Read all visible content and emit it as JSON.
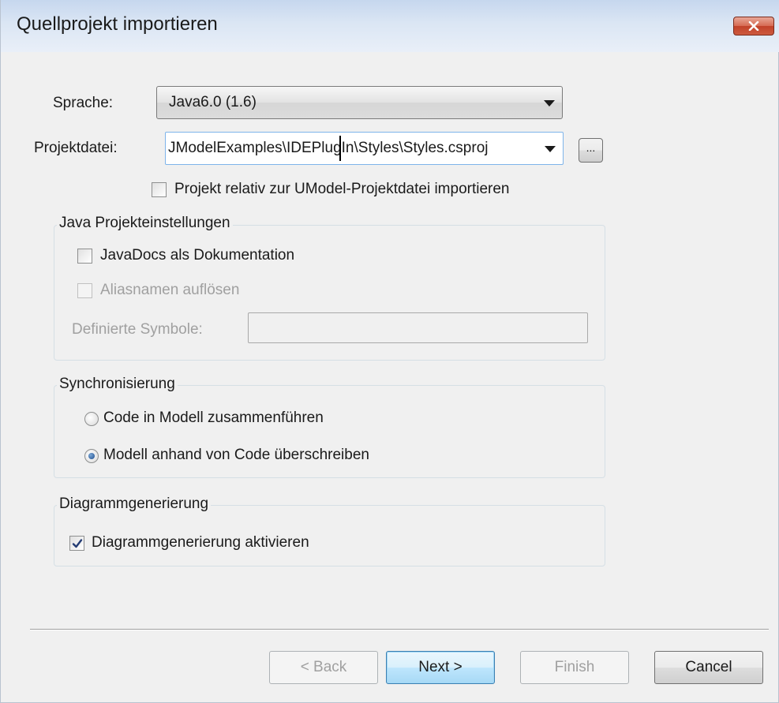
{
  "window": {
    "title": "Quellprojekt importieren",
    "close_glyph": "✕"
  },
  "form": {
    "language_label": "Sprache:",
    "language_value": "Java6.0 (1.6)",
    "project_label": "Projektdatei:",
    "project_value": "JModelExamples\\IDEPlugIn\\Styles\\Styles.csproj",
    "browse_label": "...",
    "relative_checkbox_label": "Projekt relativ zur UModel-Projektdatei importieren",
    "relative_checked": false
  },
  "java_group": {
    "title": "Java Projekteinstellungen",
    "javadocs_label": "JavaDocs als Dokumentation",
    "javadocs_checked": false,
    "alias_label": "Aliasnamen auflösen",
    "alias_checked": false,
    "alias_enabled": false,
    "symbols_label": "Definierte Symbole:",
    "symbols_value": ""
  },
  "sync_group": {
    "title": "Synchronisierung",
    "options": [
      {
        "label": "Code in Modell zusammenführen",
        "selected": false
      },
      {
        "label": "Modell anhand von Code überschreiben",
        "selected": true
      }
    ]
  },
  "diagram_group": {
    "title": "Diagrammgenerierung",
    "enable_label": "Diagrammgenerierung aktivieren",
    "enable_checked": true
  },
  "buttons": {
    "back": "< Back",
    "next": "Next >",
    "finish": "Finish",
    "cancel": "Cancel"
  },
  "colors": {
    "titlebar": "#c6d7ee",
    "dialog_bg": "#f0f0f0",
    "close_button": "#c2422a",
    "default_button": "#3c7fb1",
    "disabled_text": "#a0a0a0"
  }
}
